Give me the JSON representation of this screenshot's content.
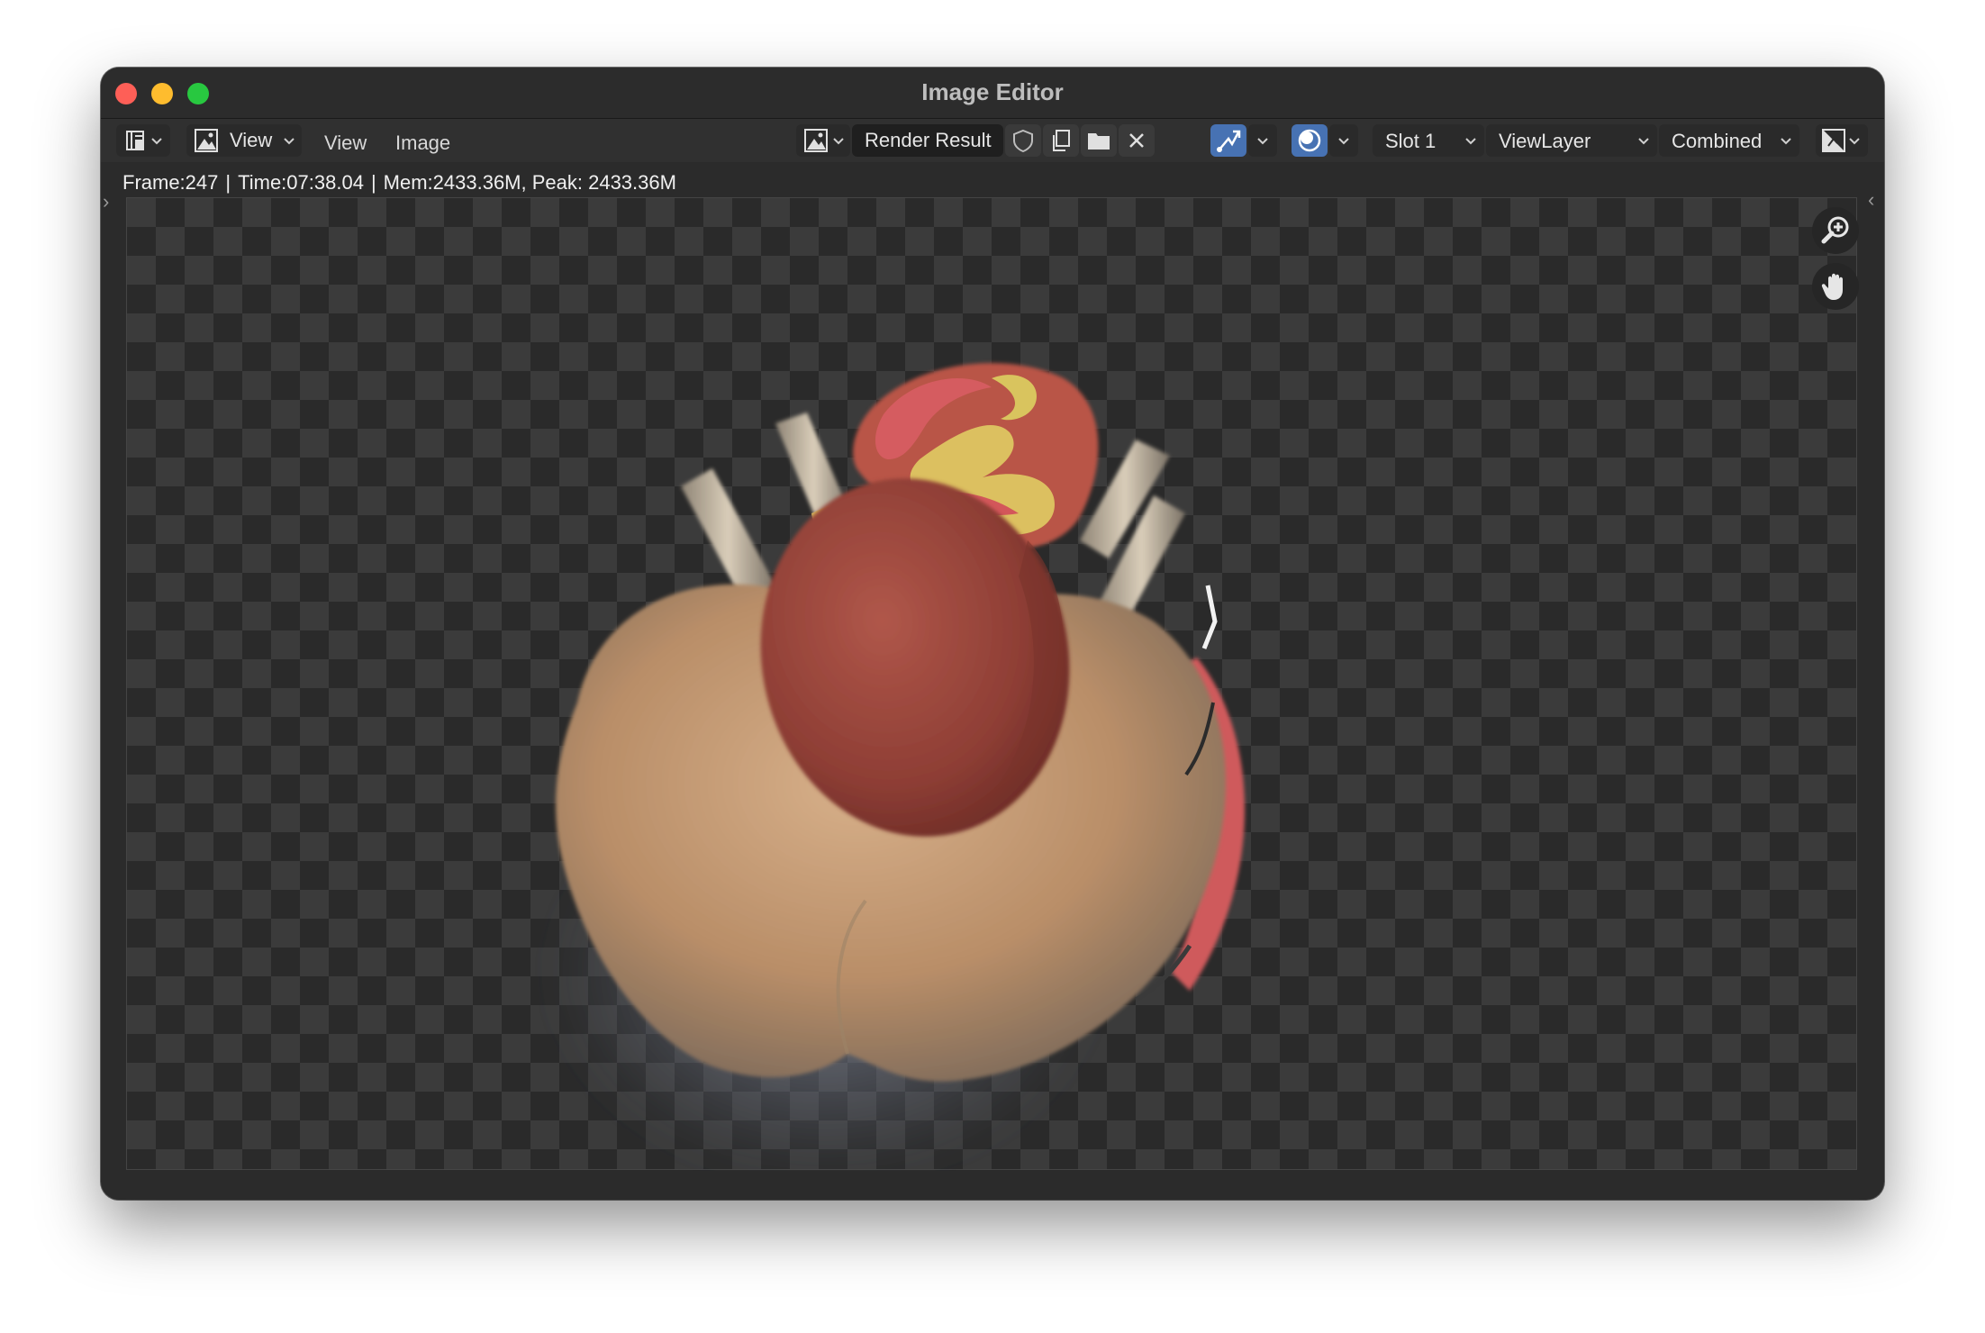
{
  "window": {
    "title": "Image Editor"
  },
  "header": {
    "editor_type_icon": "image-editor-icon",
    "mode_label": "View",
    "menus": [
      "View",
      "Image"
    ],
    "image_browse_icon": "image-icon",
    "image_name": "Render Result",
    "fake_user_icon": "shield-icon",
    "duplicate_icon": "duplicate-icon",
    "open_icon": "folder-icon",
    "unlink_icon": "close-icon",
    "gizmo_icon": "gizmo-icon",
    "overlay_icon": "overlay-icon",
    "slot": "Slot 1",
    "view_layer": "ViewLayer",
    "pass": "Combined",
    "display_channels_icon": "display-channels-icon"
  },
  "status": {
    "frame": "Frame:247",
    "time": "Time:07:38.04",
    "memory": "Mem:2433.36M, Peak: 2433.36M"
  },
  "viewport": {
    "content": "render-result"
  },
  "navigation": {
    "zoom_icon": "zoom-icon",
    "pan_icon": "hand-icon"
  }
}
